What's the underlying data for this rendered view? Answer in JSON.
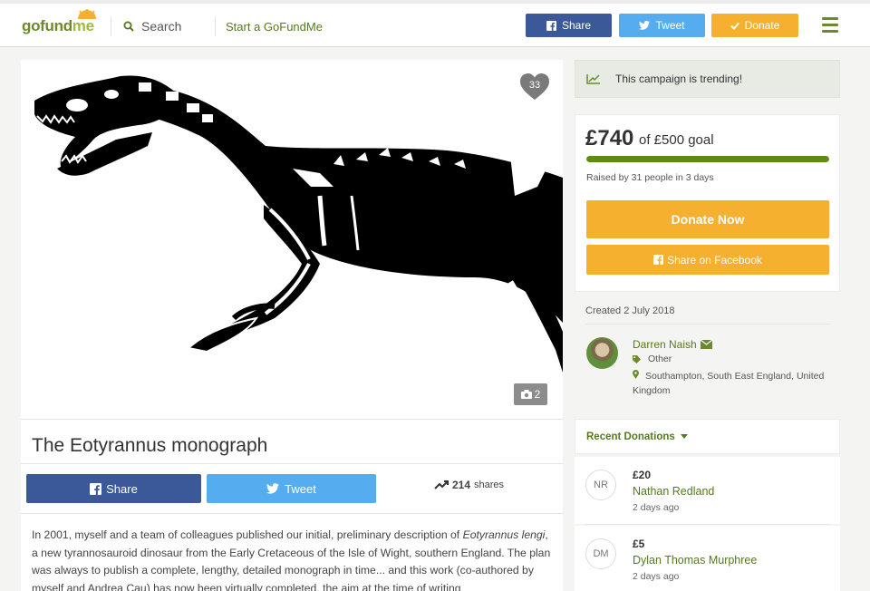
{
  "header": {
    "logo": {
      "go": "go",
      "fund": "fund",
      "me": "me"
    },
    "search_label": "Search",
    "start_label": "Start a GoFundMe",
    "share_label": "Share",
    "tweet_label": "Tweet",
    "donate_label": "Donate"
  },
  "campaign": {
    "photo_count": "2",
    "heart_count": "33",
    "title": "The Eotyrannus monograph",
    "share_label": "Share",
    "tweet_label": "Tweet",
    "shares_count": "214",
    "shares_label": "shares",
    "description": {
      "part1": "In 2001, myself and a team of colleagues published our initial, preliminary description of ",
      "italic1": "Eotyrannus",
      "part2": " ",
      "italic2": "lengi",
      "part3": ", a new tyrannosauroid dinosaur from the Early Cretaceous of the Isle of Wight, southern England. The plan was always to publish a complete, lengthy, detailed monograph in time... and this work (co-authored by myself and Andrea Cau) has now been virtually completed, the aim at the time of writing"
    }
  },
  "sidebar": {
    "trending_text": "This campaign is trending!",
    "raised_amount": "£740",
    "goal_text": "of £500 goal",
    "progress_fraction": 1.0,
    "raised_by": "Raised by 31 people in 3 days",
    "donate_now_label": "Donate Now",
    "share_facebook_label": "Share on Facebook",
    "created": "Created 2 July 2018",
    "organizer": {
      "name": "Darren Naish",
      "category": "Other",
      "location": "Southampton, South East England, United Kingdom"
    },
    "recent_donations_label": "Recent Donations",
    "donations": [
      {
        "initials": "NR",
        "amount": "£20",
        "name": "Nathan Redland",
        "time": "2 days ago"
      },
      {
        "initials": "DM",
        "amount": "£5",
        "name": "Dylan Thomas Murphree",
        "time": "2 days ago"
      }
    ]
  },
  "colors": {
    "brand_green": "#6c8a2a",
    "facebook_blue": "#3b5998",
    "twitter_blue": "#55acee",
    "donate_orange": "#f6b030",
    "progress_green": "#5e8a17"
  },
  "icons": [
    "search-icon",
    "facebook-icon",
    "twitter-icon",
    "check-icon",
    "menu-icon",
    "heart-icon",
    "camera-icon",
    "trending-icon",
    "envelope-icon",
    "tag-icon",
    "location-pin-icon",
    "caret-down-icon"
  ]
}
